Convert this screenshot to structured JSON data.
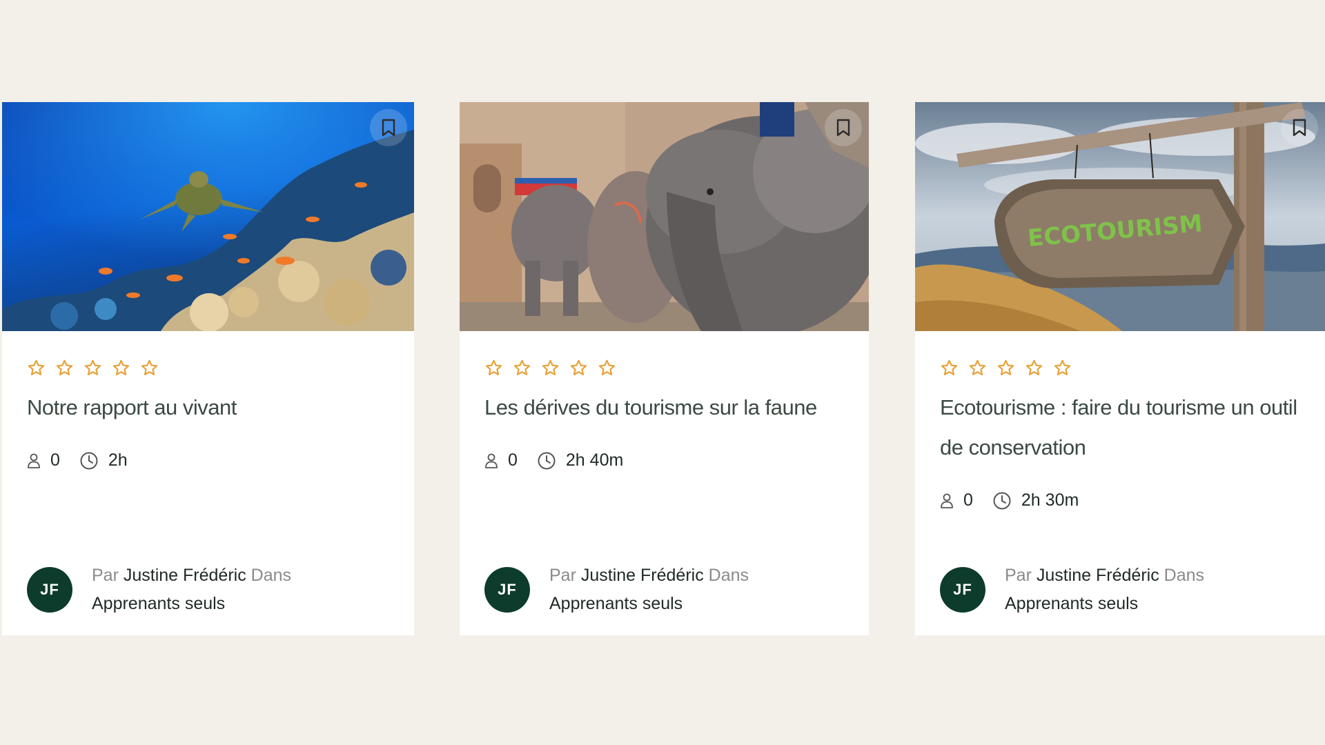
{
  "colors": {
    "background": "#f3f0e9",
    "card": "#ffffff",
    "star": "#e8a23a",
    "avatar": "#0d3b2c",
    "title": "#3b4a42",
    "muted": "#8a8a8a"
  },
  "icons": {
    "bookmark": "bookmark-icon",
    "star": "star-outline-icon",
    "students": "user-icon",
    "duration": "clock-icon"
  },
  "courses": [
    {
      "image": "sea-turtle-coral-reef-photo",
      "rating": 0,
      "title": "Notre rapport au vivant",
      "students": "0",
      "duration": "2h",
      "author_prefix": "Par",
      "author_name": "Justine Frédéric",
      "author_in": "Dans",
      "category": "Apprenants seuls",
      "initials": "JF"
    },
    {
      "image": "elephants-street-photo",
      "rating": 0,
      "title": "Les dérives du tourisme sur la faune",
      "students": "0",
      "duration": "2h 40m",
      "author_prefix": "Par",
      "author_name": "Justine Frédéric",
      "author_in": "Dans",
      "category": "Apprenants seuls",
      "initials": "JF"
    },
    {
      "image": "ecotourism-wooden-sign-photo",
      "image_sign_text": "ECOTOURISM",
      "rating": 0,
      "title": "Ecotourisme : faire du tourisme un outil de conservation",
      "students": "0",
      "duration": "2h 30m",
      "author_prefix": "Par",
      "author_name": "Justine Frédéric",
      "author_in": "Dans",
      "category": "Apprenants seuls",
      "initials": "JF"
    }
  ]
}
